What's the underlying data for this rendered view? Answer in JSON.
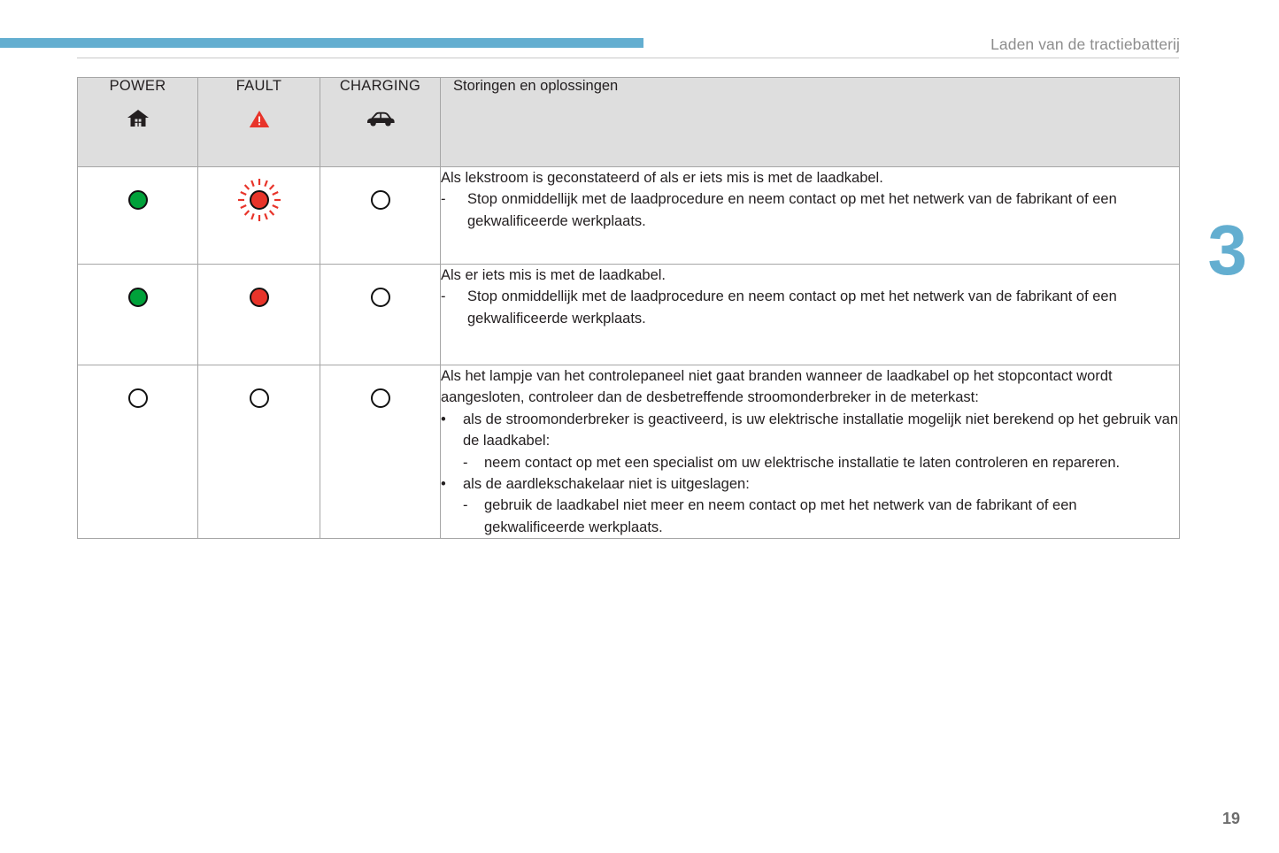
{
  "header": {
    "title": "Laden van de tractiebatterij",
    "accent_color": "#63aed0"
  },
  "chapter": {
    "number": "3",
    "color": "#63aed0"
  },
  "footer": {
    "page_number": "19"
  },
  "table": {
    "columns": [
      {
        "label": "POWER",
        "icon": "house-icon"
      },
      {
        "label": "FAULT",
        "icon": "warning-triangle-icon"
      },
      {
        "label": "CHARGING",
        "icon": "car-icon"
      }
    ],
    "description_header": "Storingen en oplossingen",
    "colors": {
      "header_background": "#dedede",
      "border": "#a6a6a6",
      "lamp_green": "#00a13a",
      "lamp_red": "#e8342a",
      "lamp_off": "#ffffff",
      "warning_red": "#e8342a"
    },
    "rows": [
      {
        "lamps": [
          {
            "name": "power-lamp-green",
            "state": "green"
          },
          {
            "name": "fault-lamp-red-blinking",
            "state": "red-blinking"
          },
          {
            "name": "charging-lamp-off",
            "state": "off"
          }
        ],
        "intro": "Als lekstroom is geconstateerd of als er iets mis is met de laadkabel.",
        "items": [
          {
            "marker": "-",
            "text": "Stop onmiddellijk met de laadprocedure en neem contact op met het netwerk van de fabrikant of een gekwalificeerde werkplaats."
          }
        ]
      },
      {
        "lamps": [
          {
            "name": "power-lamp-green",
            "state": "green"
          },
          {
            "name": "fault-lamp-red",
            "state": "red"
          },
          {
            "name": "charging-lamp-off",
            "state": "off"
          }
        ],
        "intro": "Als er iets mis is met de laadkabel.",
        "items": [
          {
            "marker": "-",
            "text": "Stop onmiddellijk met de laadprocedure en neem contact op met het netwerk van de fabrikant of een gekwalificeerde werkplaats."
          }
        ]
      },
      {
        "lamps": [
          {
            "name": "power-lamp-off",
            "state": "off"
          },
          {
            "name": "fault-lamp-off",
            "state": "off"
          },
          {
            "name": "charging-lamp-off",
            "state": "off"
          }
        ],
        "intro": "Als het lampje van het controlepaneel niet gaat branden wanneer de laadkabel op het stopcontact wordt aangesloten, controleer dan de desbetreffende stroomonderbreker in de meterkast:",
        "items": [
          {
            "marker": "•",
            "text": "als de stroomonderbreker is geactiveerd, is uw elektrische installatie mogelijk niet berekend op het gebruik van de laadkabel:"
          },
          {
            "marker": "-",
            "sub": true,
            "text": "neem contact op met een specialist om uw elektrische installatie te laten controleren en repareren."
          },
          {
            "marker": "•",
            "text": "als de aardlekschakelaar niet is uitgeslagen:"
          },
          {
            "marker": "-",
            "sub": true,
            "text": "gebruik de laadkabel niet meer en neem contact op met het netwerk van de fabrikant of een gekwalificeerde werkplaats."
          }
        ]
      }
    ]
  }
}
